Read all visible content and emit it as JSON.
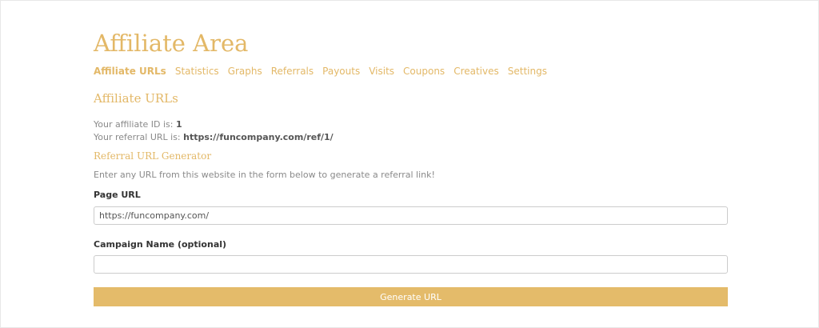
{
  "page": {
    "title": "Affiliate Area"
  },
  "tabs": [
    {
      "label": "Affiliate URLs",
      "active": true
    },
    {
      "label": "Statistics"
    },
    {
      "label": "Graphs"
    },
    {
      "label": "Referrals"
    },
    {
      "label": "Payouts"
    },
    {
      "label": "Visits"
    },
    {
      "label": "Coupons"
    },
    {
      "label": "Creatives"
    },
    {
      "label": "Settings"
    }
  ],
  "affiliate_urls": {
    "heading": "Affiliate URLs",
    "affiliate_id_label": "Your affiliate ID is:",
    "affiliate_id_value": "1",
    "referral_url_label": "Your referral URL is:",
    "referral_url_value": "https://funcompany.com/ref/1/"
  },
  "generator": {
    "heading": "Referral URL Generator",
    "help_text": "Enter any URL from this website in the form below to generate a referral link!",
    "page_url_label": "Page URL",
    "page_url_value": "https://funcompany.com/",
    "campaign_label": "Campaign Name (optional)",
    "campaign_value": "",
    "button_label": "Generate URL"
  },
  "colors": {
    "accent": "#e3b867",
    "button": "#e4bb6a"
  }
}
